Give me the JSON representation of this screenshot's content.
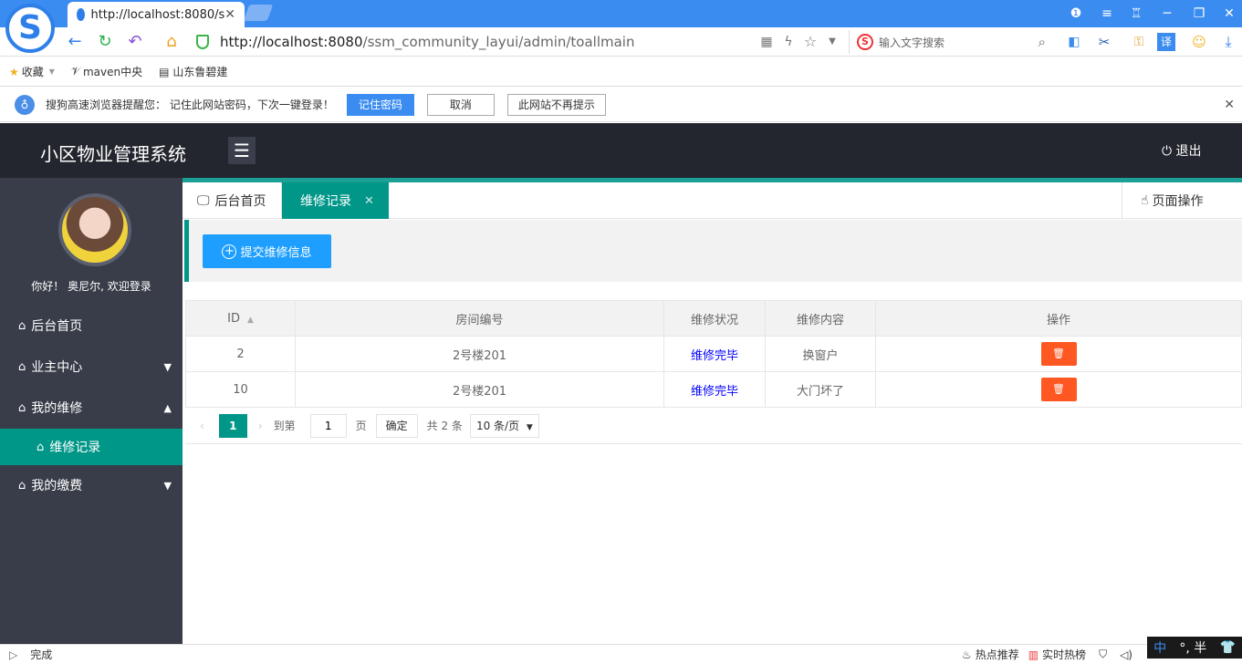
{
  "browser": {
    "tab_title": "http://localhost:8080/s",
    "url_host": "http://localhost:8080",
    "url_path": "/ssm_community_layui/admin/toallmain",
    "search_placeholder": "输入文字搜索",
    "bookmarks": [
      "收藏",
      "maven中央",
      "山东鲁碧建"
    ],
    "notify_text": "搜狗高速浏览器提醒您：  记住此网站密码，下次一键登录！",
    "notify_buttons": {
      "remember": "记住密码",
      "cancel": "取消",
      "never": "此网站不再提示"
    },
    "status_left": "完成",
    "status_right": [
      "热点推荐",
      "实时热榜"
    ],
    "ime_text": "°, 半"
  },
  "app": {
    "title": "小区物业管理系统",
    "logout": "退出",
    "welcome": "你好！ 奥尼尔, 欢迎登录",
    "menu": {
      "home": "后台首页",
      "owner": "业主中心",
      "repair": "我的维修",
      "repair_record": "维修记录",
      "fee": "我的缴费"
    },
    "tabs": {
      "home": "后台首页",
      "repair": "维修记录"
    },
    "page_ops": "页面操作",
    "submit_button": "提交维修信息",
    "table": {
      "headers": [
        "ID",
        "房间编号",
        "维修状况",
        "维修内容",
        "操作"
      ],
      "rows": [
        {
          "id": "2",
          "room": "2号楼201",
          "status": "维修完毕",
          "content": "换窗户"
        },
        {
          "id": "10",
          "room": "2号楼201",
          "status": "维修完毕",
          "content": "大门坏了"
        }
      ]
    },
    "pager": {
      "current": "1",
      "goto": "到第",
      "page_input": "1",
      "page_unit": "页",
      "confirm": "确定",
      "total": "共 2 条",
      "per_page": "10 条/页"
    }
  },
  "colors": {
    "header_bg": "#23262e",
    "sidebar_bg": "#393d49",
    "accent": "#009688",
    "primary_btn": "#1e9fff",
    "danger_btn": "#ff5722",
    "browser_blue": "#3b8cf0"
  }
}
